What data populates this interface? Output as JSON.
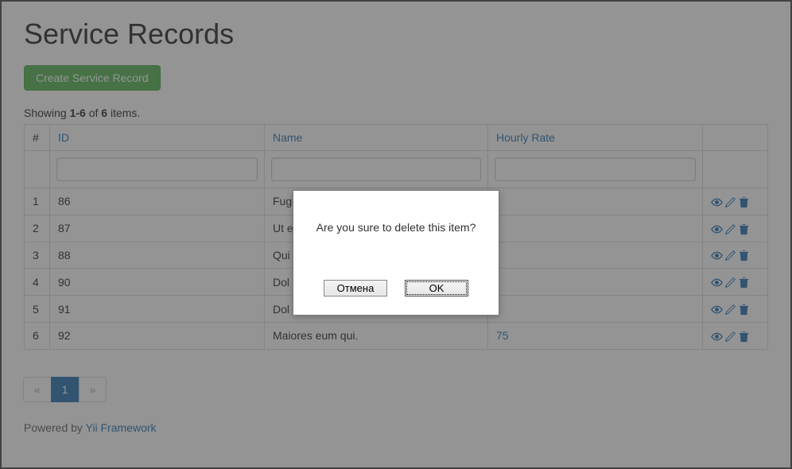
{
  "page": {
    "title": "Service Records"
  },
  "buttons": {
    "create": "Create Service Record"
  },
  "summary": {
    "prefix": "Showing ",
    "range": "1-6",
    "mid": " of ",
    "total": "6",
    "suffix": " items."
  },
  "table": {
    "headers": {
      "num": "#",
      "id": "ID",
      "name": "Name",
      "rate": "Hourly Rate"
    },
    "rows": [
      {
        "num": "1",
        "id": "86",
        "name": "Fug",
        "rate": ""
      },
      {
        "num": "2",
        "id": "87",
        "name": "Ut e",
        "rate": ""
      },
      {
        "num": "3",
        "id": "88",
        "name": "Qui",
        "rate": ""
      },
      {
        "num": "4",
        "id": "90",
        "name": "Dol",
        "rate": ""
      },
      {
        "num": "5",
        "id": "91",
        "name": "Dol",
        "rate": ""
      },
      {
        "num": "6",
        "id": "92",
        "name": "Maiores eum qui.",
        "rate": "75"
      }
    ]
  },
  "pagination": {
    "prev": "«",
    "page1": "1",
    "next": "»"
  },
  "footer": {
    "prefix": "Powered by ",
    "link": "Yii Framework"
  },
  "dialog": {
    "message": "Are you sure to delete this item?",
    "cancel": "Отмена",
    "ok": "OK"
  }
}
